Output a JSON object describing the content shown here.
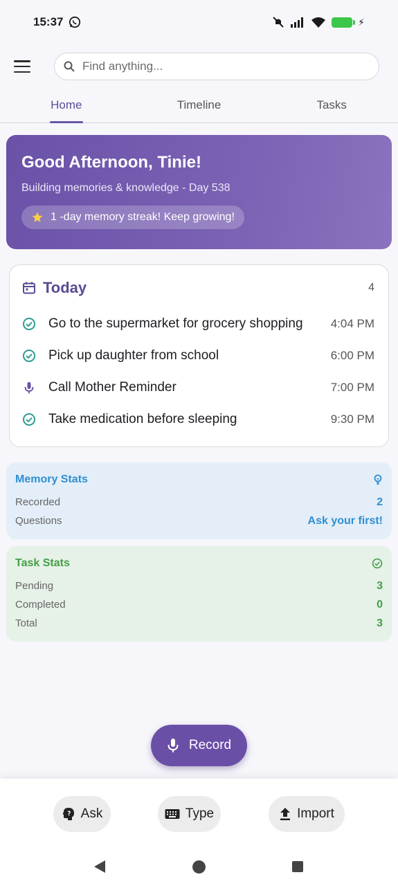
{
  "status_bar": {
    "time": "15:37",
    "icons": [
      "whatsapp-icon",
      "mute-icon",
      "signal-icon",
      "wifi-icon",
      "battery-charging-icon"
    ]
  },
  "header": {
    "menu_icon": "menu-icon",
    "search": {
      "placeholder": "Find anything...",
      "value": ""
    }
  },
  "tabs": [
    {
      "label": "Home",
      "active": true
    },
    {
      "label": "Timeline",
      "active": false
    },
    {
      "label": "Tasks",
      "active": false
    }
  ],
  "greeting": {
    "title": "Good Afternoon, Tinie!",
    "subtitle": "Building memories & knowledge - Day 538",
    "streak": "1 -day memory streak! Keep growing!"
  },
  "today": {
    "title": "Today",
    "count": "4",
    "items": [
      {
        "label": "Go to the supermarket for grocery shopping",
        "time": "4:04 PM",
        "icon": "check-circle-icon"
      },
      {
        "label": "Pick up daughter from school",
        "time": "6:00 PM",
        "icon": "check-circle-icon"
      },
      {
        "label": "Call Mother Reminder",
        "time": "7:00 PM",
        "icon": "microphone-icon"
      },
      {
        "label": "Take medication before sleeping",
        "time": "9:30 PM",
        "icon": "check-circle-icon"
      }
    ]
  },
  "memory_stats": {
    "title": "Memory Stats",
    "rows": [
      {
        "label": "Recorded",
        "value": "2"
      },
      {
        "label": "Questions",
        "value": "Ask your first!"
      }
    ]
  },
  "task_stats": {
    "title": "Task Stats",
    "rows": [
      {
        "label": "Pending",
        "value": "3"
      },
      {
        "label": "Completed",
        "value": "0"
      },
      {
        "label": "Total",
        "value": "3"
      }
    ]
  },
  "record_button": "Record",
  "actions": {
    "ask": "Ask",
    "type": "Type",
    "import": "Import"
  },
  "colors": {
    "accent": "#6a4fa6",
    "memory": "#2f8fd1",
    "task": "#43a047"
  }
}
